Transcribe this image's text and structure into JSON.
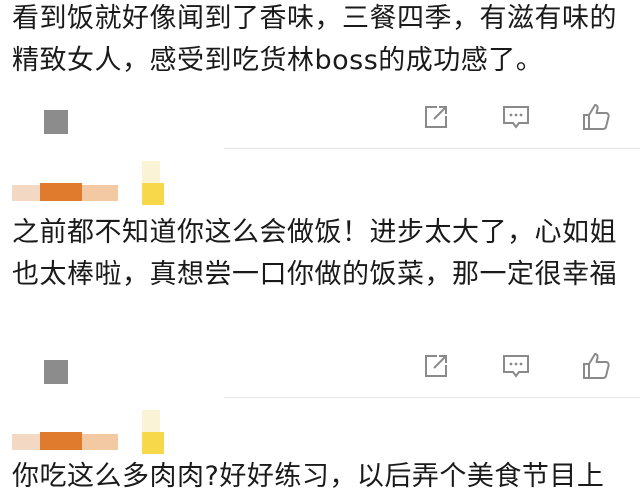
{
  "comments": [
    {
      "text": "看到饭就好像闻到了香味，三餐四季，有滋有味的精致女人，感受到吃货林boss的成功感了。",
      "actions": [
        "share-icon",
        "comment-icon",
        "like-icon"
      ]
    },
    {
      "text": "之前都不知道你这么会做饭！进步太大了，心如姐也太棒啦，真想尝一口你做的饭菜，那一定很幸福",
      "actions": [
        "share-icon",
        "comment-icon",
        "like-icon"
      ]
    },
    {
      "text": "你吃这么多肉肉?好好练习，以后弄个美食节目上",
      "actions": []
    }
  ],
  "colors": {
    "icon": "#8a8a8a",
    "mosaic_gray": "#8c8c8c",
    "mosaic_orange": "#e07b2e",
    "mosaic_light_orange": "#f2c9a3",
    "mosaic_yellow": "#f7d84a",
    "divider": "#e6e6e6"
  }
}
